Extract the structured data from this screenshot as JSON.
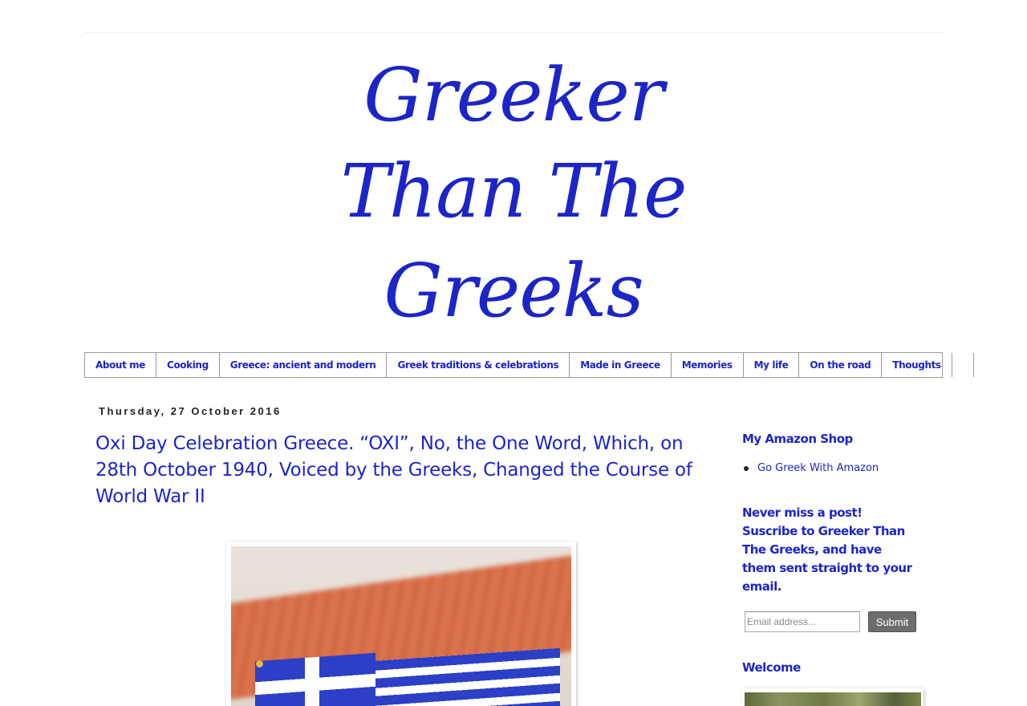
{
  "header": {
    "logo_line1": "Greeker",
    "logo_line2": "Than The",
    "logo_line3": "Greeks"
  },
  "nav": {
    "items": [
      {
        "label": "About me"
      },
      {
        "label": "Cooking"
      },
      {
        "label": "Greece: ancient and modern"
      },
      {
        "label": "Greek traditions & celebrations"
      },
      {
        "label": "Made in Greece"
      },
      {
        "label": "Memories"
      },
      {
        "label": "My life"
      },
      {
        "label": "On the road"
      },
      {
        "label": "Thoughts"
      }
    ]
  },
  "post": {
    "date": "Thursday, 27 October 2016",
    "title": "Oxi Day Celebration Greece. “OXI”, No, the One Word, Which, on 28th October 1940, Voiced by the Greeks, Changed the Course of World War II"
  },
  "sidebar": {
    "amazon_heading": "My Amazon Shop",
    "amazon_link": "Go Greek With Amazon",
    "subscribe_heading": "Never miss a post! Suscribe to Greeker Than The Greeks, and have them sent straight to your email.",
    "email_placeholder": "Email address...",
    "submit_label": "Submit",
    "welcome_heading": "Welcome"
  },
  "colors": {
    "brand_blue": "#1c25c8",
    "nav_border": "#9a9a9a",
    "button_gray": "#6d6d6d"
  }
}
